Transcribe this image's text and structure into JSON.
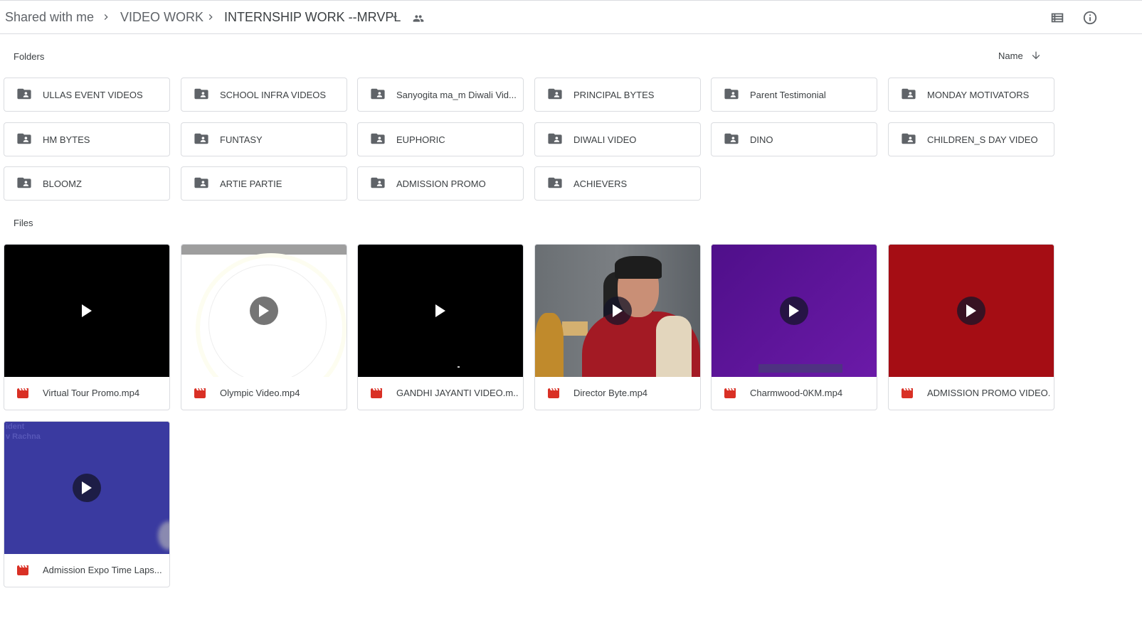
{
  "breadcrumb": {
    "items": [
      "Shared with me",
      "VIDEO WORK",
      "INTERNSHIP WORK --MRVPL"
    ]
  },
  "toolbar": {
    "list_view_icon": "list-view-icon",
    "info_icon": "info-icon",
    "shared_icon": "people-icon",
    "dropdown_icon": "arrow-drop-down-icon"
  },
  "sections": {
    "folders_label": "Folders",
    "files_label": "Files",
    "sort_label": "Name",
    "sort_icon": "arrow-down-icon"
  },
  "folders": [
    {
      "name": "ULLAS EVENT VIDEOS"
    },
    {
      "name": "SCHOOL INFRA VIDEOS"
    },
    {
      "name": "Sanyogita ma_m Diwali Vid..."
    },
    {
      "name": "PRINCIPAL BYTES"
    },
    {
      "name": "Parent Testimonial"
    },
    {
      "name": "MONDAY MOTIVATORS"
    },
    {
      "name": "HM BYTES"
    },
    {
      "name": "FUNTASY"
    },
    {
      "name": "EUPHORIC"
    },
    {
      "name": "DIWALI VIDEO"
    },
    {
      "name": "DINO"
    },
    {
      "name": "CHILDREN_S DAY VIDEO"
    },
    {
      "name": "BLOOMZ"
    },
    {
      "name": "ARTIE PARTIE"
    },
    {
      "name": "ADMISSION PROMO"
    },
    {
      "name": "ACHIEVERS"
    }
  ],
  "files": [
    {
      "name": "Virtual Tour Promo.mp4",
      "thumb_color": "#000000"
    },
    {
      "name": "Olympic Video.mp4",
      "thumb_color": "#ffffff"
    },
    {
      "name": "GANDHI JAYANTI VIDEO.m...",
      "thumb_color": "#000000"
    },
    {
      "name": "Director Byte.mp4",
      "thumb_color": "#6f7479"
    },
    {
      "name": "Charmwood-0KM.mp4",
      "thumb_color": "#5a1496"
    },
    {
      "name": "ADMISSION PROMO VIDEO...",
      "thumb_color": "#a50d14"
    },
    {
      "name": "Admission Expo Time Laps...",
      "thumb_color": "#3a3aa0"
    }
  ],
  "colors": {
    "video_icon": "#d93025",
    "folder_icon": "#5f6368",
    "border": "#dadce0"
  }
}
